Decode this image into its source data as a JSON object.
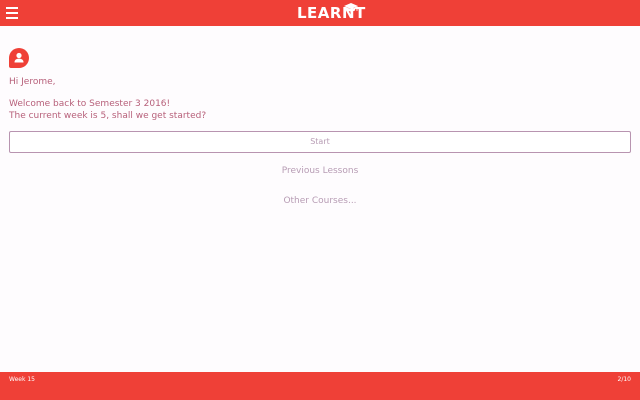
{
  "header": {
    "logo_text": "LEARNT",
    "menu_icon": "hamburger-menu-icon",
    "logo_icon": "graduation-cap-icon",
    "accent_color": "#ef4037"
  },
  "user": {
    "avatar_icon": "user-avatar-icon",
    "greeting": "Hi Jerome,"
  },
  "welcome": {
    "line1": "Welcome back to Semester 3 2016!",
    "line2": "The current week is 5, shall we get started?"
  },
  "actions": {
    "start_label": "Start",
    "previous_lessons_label": "Previous Lessons",
    "other_courses_label": "Other Courses..."
  },
  "footer": {
    "week_label": "Week 15",
    "page_indicator": "2/10"
  }
}
